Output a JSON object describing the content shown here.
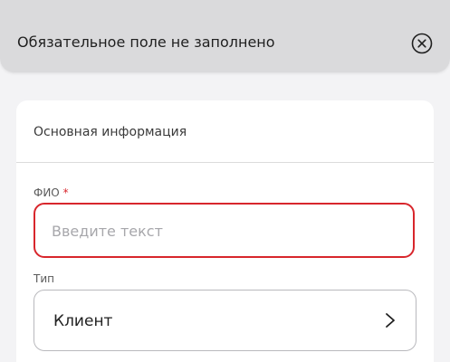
{
  "toast": {
    "message": "Обязательное поле не заполнено",
    "close_icon": "close-circle-icon"
  },
  "form": {
    "section_title": "Основная информация",
    "fio": {
      "label": "ФИО",
      "required_mark": "*",
      "placeholder": "Введите текст",
      "value": "",
      "error": true
    },
    "type": {
      "label": "Тип",
      "selected": "Клиент",
      "chevron_icon": "chevron-right-icon"
    }
  },
  "colors": {
    "error": "#d8262c",
    "toast_bg": "#dadadc",
    "background": "#f3f3f5"
  }
}
